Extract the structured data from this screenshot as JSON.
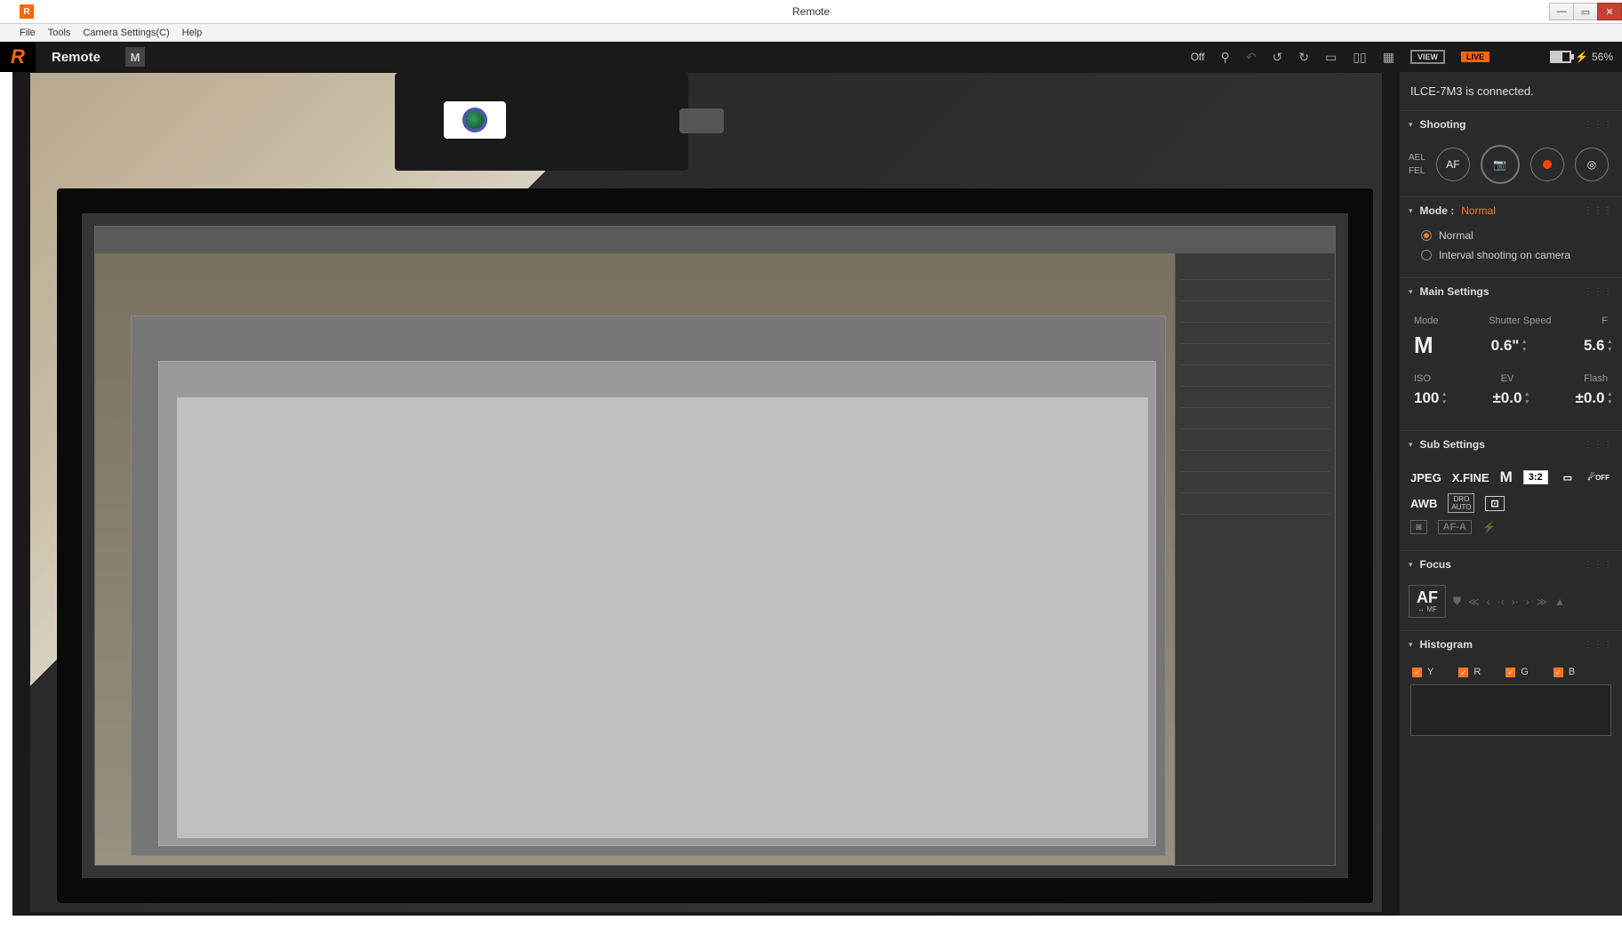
{
  "window": {
    "title": "Remote",
    "icon_letter": "R"
  },
  "menu": {
    "file": "File",
    "tools": "Tools",
    "camera": "Camera Settings(C)",
    "help": "Help"
  },
  "header": {
    "app_name": "Remote",
    "mode_m": "M",
    "off": "Off",
    "view": "VIEW",
    "live": "LIVE",
    "battery_pct": "56%"
  },
  "status": {
    "connected_msg": "ILCE-7M3 is connected."
  },
  "shooting": {
    "title": "Shooting",
    "ael": "AEL",
    "fel": "FEL",
    "af": "AF"
  },
  "mode": {
    "label": "Mode :",
    "value": "Normal",
    "opt_normal": "Normal",
    "opt_interval": "Interval shooting on camera"
  },
  "main": {
    "title": "Main Settings",
    "labels": {
      "mode": "Mode",
      "shutter": "Shutter Speed",
      "f": "F",
      "iso": "ISO",
      "ev": "EV",
      "flash": "Flash"
    },
    "values": {
      "mode": "M",
      "shutter": "0.6\"",
      "f": "5.6",
      "iso": "100",
      "ev": "±0.0",
      "flash": "±0.0"
    }
  },
  "sub": {
    "title": "Sub Settings",
    "jpeg": "JPEG",
    "xfine": "X.FINE",
    "size_m": "M",
    "ratio": "3:2",
    "off": "OFF",
    "awb": "AWB",
    "dro1": "DRO",
    "dro2": "AUTO",
    "afa": "AF-A"
  },
  "focus": {
    "title": "Focus",
    "af": "AF",
    "mf": "↔ MF"
  },
  "hist": {
    "title": "Histogram",
    "y": "Y",
    "r": "R",
    "g": "G",
    "b": "B"
  }
}
